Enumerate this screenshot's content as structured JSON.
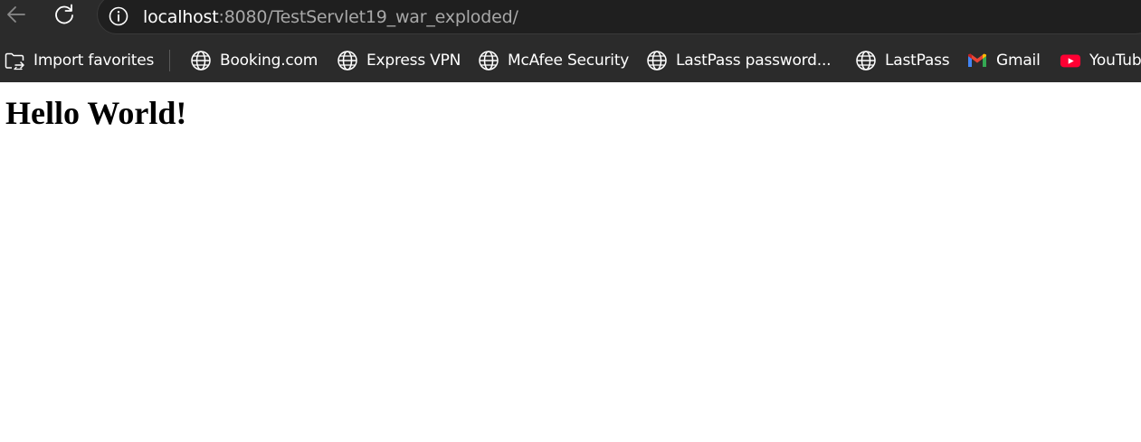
{
  "address_bar": {
    "host": "localhost",
    "path": ":8080/TestServlet19_war_exploded/"
  },
  "bookmarks": {
    "import_label": "Import favorites",
    "items": [
      {
        "label": "Booking.com",
        "icon": "globe-icon"
      },
      {
        "label": "Express VPN",
        "icon": "globe-icon"
      },
      {
        "label": "McAfee Security",
        "icon": "globe-icon"
      },
      {
        "label": "LastPass password...",
        "icon": "globe-icon"
      },
      {
        "label": "LastPass",
        "icon": "globe-icon"
      },
      {
        "label": "Gmail",
        "icon": "gmail-icon"
      },
      {
        "label": "YouTube",
        "icon": "youtube-icon"
      }
    ]
  },
  "page": {
    "heading": "Hello World!"
  },
  "colors": {
    "chrome_bg": "#2b2b2b",
    "address_bg": "#1f1f1f",
    "youtube_red": "#ff0033"
  }
}
